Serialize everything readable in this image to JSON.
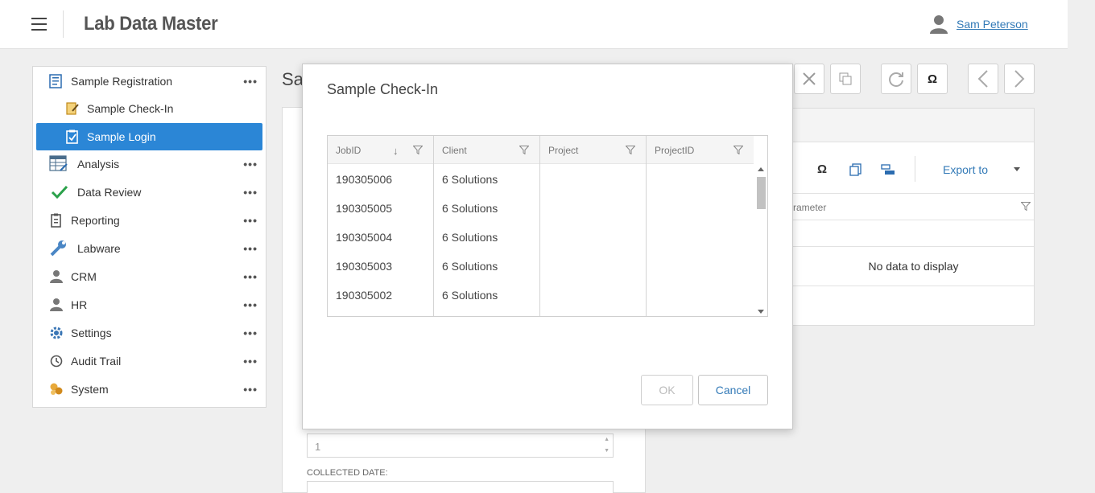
{
  "header": {
    "app_title": "Lab Data Master",
    "user_name": "Sam Peterson"
  },
  "sidebar": {
    "items": [
      {
        "label": "Sample Registration",
        "icon": "registration-icon",
        "more": "•••"
      },
      {
        "label": "Sample Check-In",
        "icon": "check-in-icon"
      },
      {
        "label": "Sample Login",
        "icon": "login-clipboard-icon",
        "active": true
      },
      {
        "label": "Analysis",
        "icon": "analysis-icon",
        "more": "•••"
      },
      {
        "label": "Data Review",
        "icon": "checkmark-icon",
        "more": "•••"
      },
      {
        "label": "Reporting",
        "icon": "clipboard-icon",
        "more": "•••"
      },
      {
        "label": "Labware",
        "icon": "wrench-icon",
        "more": "•••"
      },
      {
        "label": "CRM",
        "icon": "person-icon",
        "more": "•••"
      },
      {
        "label": "HR",
        "icon": "person-icon",
        "more": "•••"
      },
      {
        "label": "Settings",
        "icon": "gear-icon",
        "more": "•••"
      },
      {
        "label": "Audit Trail",
        "icon": "history-icon",
        "more": "•••"
      },
      {
        "label": "System",
        "icon": "system-icon",
        "more": "•••"
      }
    ]
  },
  "background": {
    "page_title_stub": "Sa",
    "omega": "Ω",
    "export_label": "Export to",
    "param_header": "rameter",
    "no_data": "No data to display",
    "field_value": "1",
    "collected_date_label": "COLLECTED DATE:"
  },
  "modal": {
    "title": "Sample Check-In",
    "columns": [
      "JobID",
      "Client",
      "Project",
      "ProjectID"
    ],
    "rows": [
      [
        "190305006",
        "6 Solutions",
        "",
        ""
      ],
      [
        "190305005",
        "6 Solutions",
        "",
        ""
      ],
      [
        "190305004",
        "6 Solutions",
        "",
        ""
      ],
      [
        "190305003",
        "6 Solutions",
        "",
        ""
      ],
      [
        "190305002",
        "6 Solutions",
        "",
        ""
      ]
    ],
    "ok_label": "OK",
    "cancel_label": "Cancel"
  },
  "colors": {
    "accent": "#2b86d6",
    "link": "#337ab7"
  }
}
